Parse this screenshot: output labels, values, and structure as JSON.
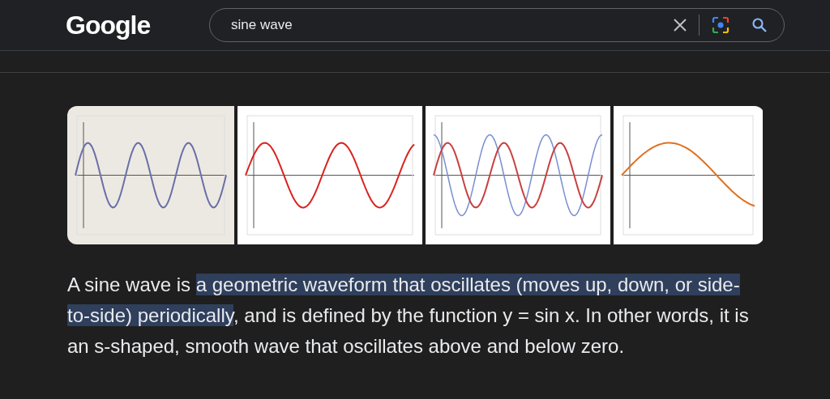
{
  "header": {
    "logo": "Google",
    "search": {
      "value": "sine wave"
    }
  },
  "answer": [
    {
      "text": "A sine wave is ",
      "highlighted": false
    },
    {
      "text": "a geometric waveform that oscillates (moves up, down, or side-to-side) periodically",
      "highlighted": true
    },
    {
      "text": ", and is defined by the function y = sin x. In other words, it is an s-shaped, smooth wave that oscillates above and below zero.",
      "highlighted": false
    }
  ]
}
